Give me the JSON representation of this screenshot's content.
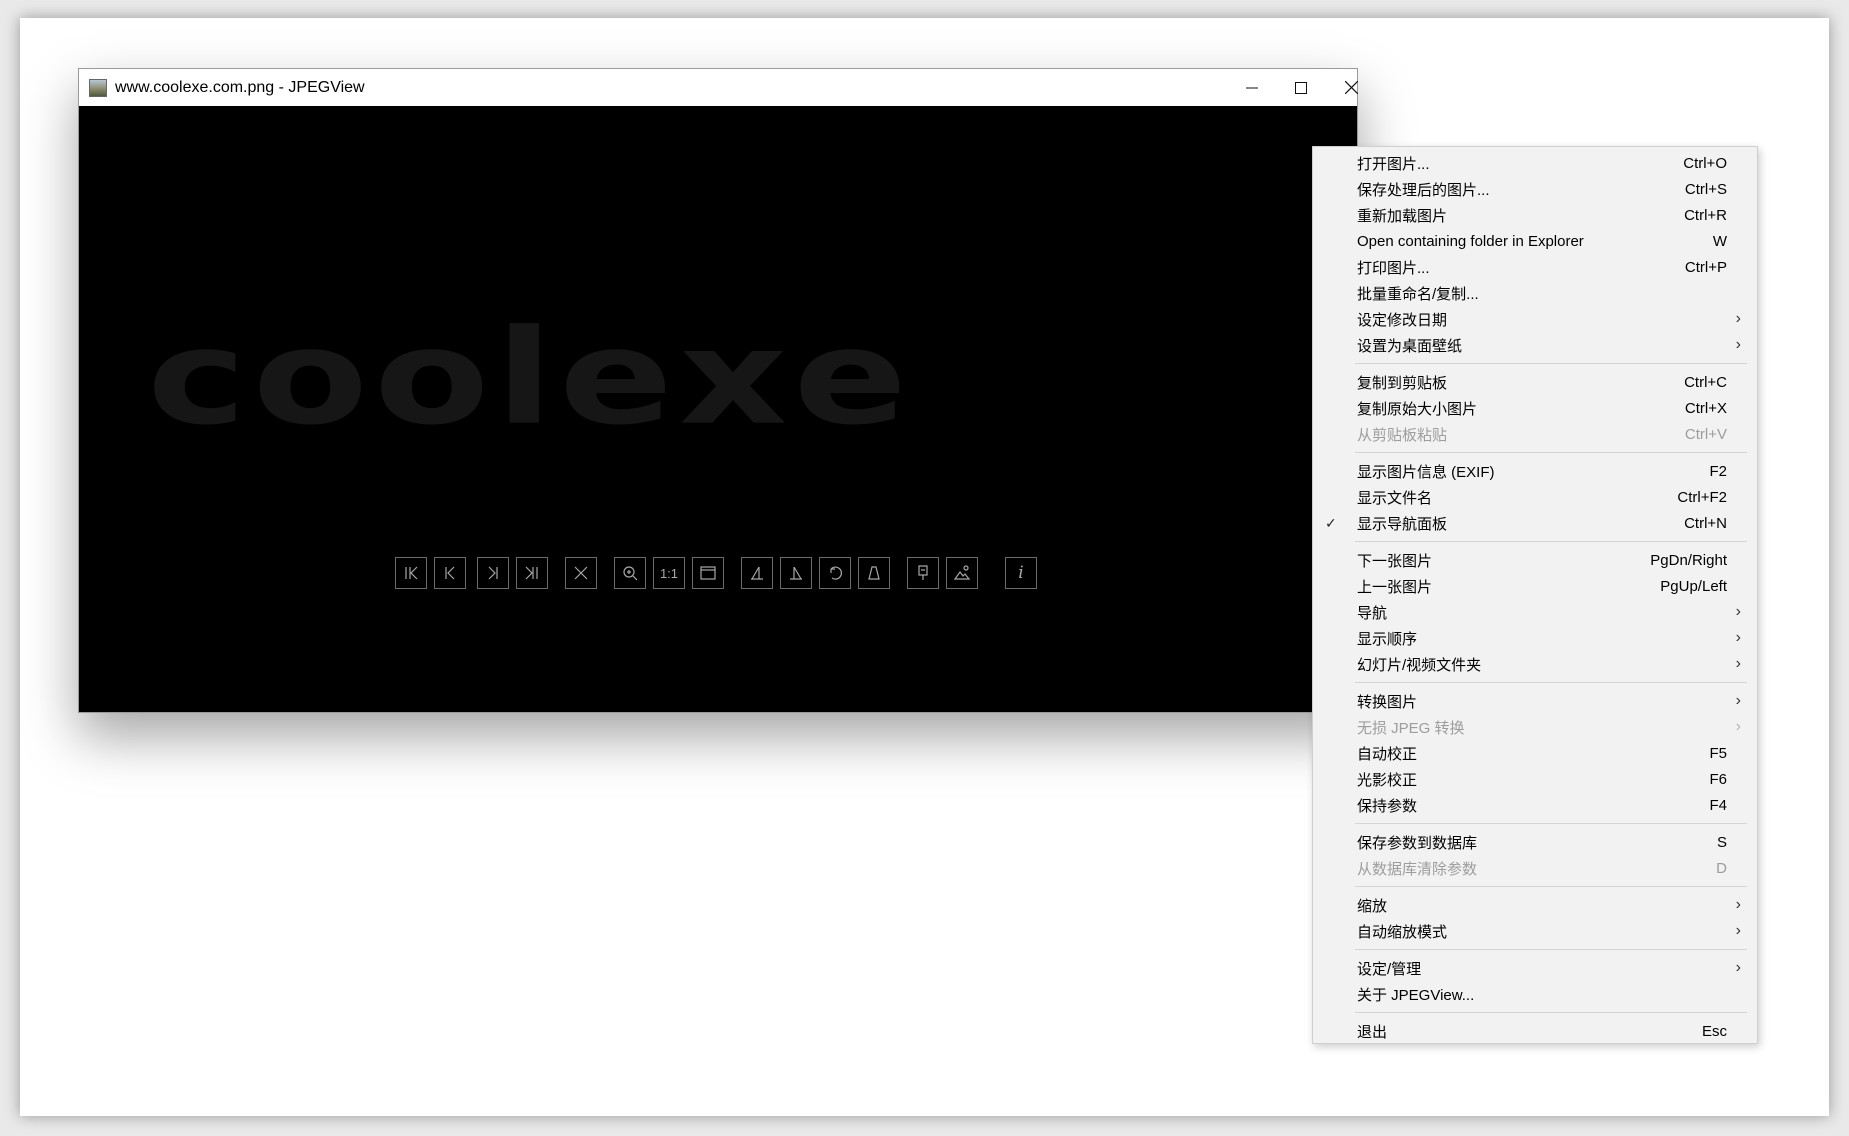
{
  "window": {
    "title": "www.coolexe.com.png - JPEGView",
    "image_text": "coolexe"
  },
  "controls": {
    "minimize": "—",
    "maximize": "☐",
    "close": "✕"
  },
  "toolbar": {
    "zoom_11_label": "1:1",
    "info_label": "i"
  },
  "menu": {
    "items": [
      {
        "label": "打开图片...",
        "shortcut": "Ctrl+O"
      },
      {
        "label": "保存处理后的图片...",
        "shortcut": "Ctrl+S"
      },
      {
        "label": "重新加载图片",
        "shortcut": "Ctrl+R"
      },
      {
        "label": "Open containing folder in Explorer",
        "shortcut": "W"
      },
      {
        "label": "打印图片...",
        "shortcut": "Ctrl+P"
      },
      {
        "label": "批量重命名/复制..."
      },
      {
        "label": "设定修改日期",
        "submenu": "›"
      },
      {
        "label": "设置为桌面壁纸",
        "submenu": "›"
      },
      {
        "label": "复制到剪贴板",
        "shortcut": "Ctrl+C"
      },
      {
        "label": "复制原始大小图片",
        "shortcut": "Ctrl+X"
      },
      {
        "label": "从剪贴板粘贴",
        "shortcut": "Ctrl+V",
        "disabled": true
      },
      {
        "label": "显示图片信息 (EXIF)",
        "shortcut": "F2"
      },
      {
        "label": "显示文件名",
        "shortcut": "Ctrl+F2"
      },
      {
        "label": "显示导航面板",
        "shortcut": "Ctrl+N",
        "checked": "✓"
      },
      {
        "label": "下一张图片",
        "shortcut": "PgDn/Right"
      },
      {
        "label": "上一张图片",
        "shortcut": "PgUp/Left"
      },
      {
        "label": "导航",
        "submenu": "›"
      },
      {
        "label": "显示顺序",
        "submenu": "›"
      },
      {
        "label": "幻灯片/视频文件夹",
        "submenu": "›"
      },
      {
        "label": "转换图片",
        "submenu": "›"
      },
      {
        "label": "无损 JPEG 转换",
        "submenu": "›",
        "disabled": true
      },
      {
        "label": "自动校正",
        "shortcut": "F5"
      },
      {
        "label": "光影校正",
        "shortcut": "F6"
      },
      {
        "label": "保持参数",
        "shortcut": "F4"
      },
      {
        "label": "保存参数到数据库",
        "shortcut": "S"
      },
      {
        "label": "从数据库清除参数",
        "shortcut": "D",
        "disabled": true
      },
      {
        "label": "缩放",
        "submenu": "›"
      },
      {
        "label": "自动缩放模式",
        "submenu": "›"
      },
      {
        "label": "设定/管理",
        "submenu": "›"
      },
      {
        "label": "关于 JPEGView..."
      },
      {
        "label": "退出",
        "shortcut": "Esc"
      }
    ]
  }
}
